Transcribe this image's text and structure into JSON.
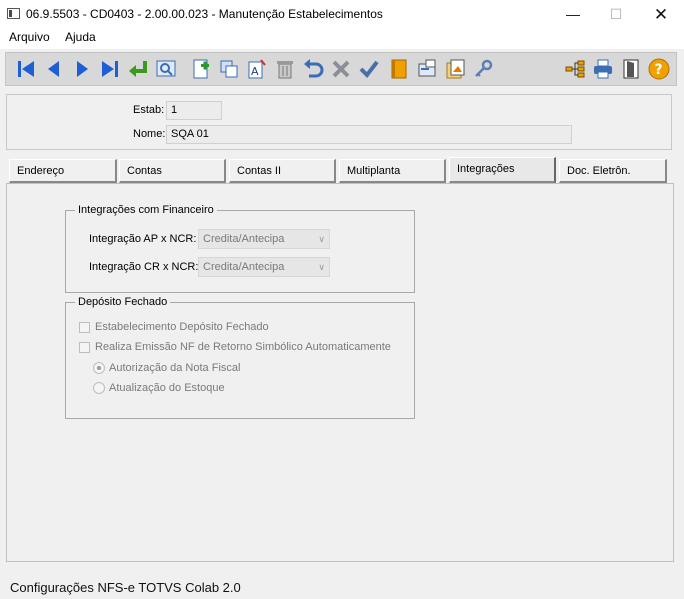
{
  "window": {
    "title": "06.9.5503 - CD0403 - 2.00.00.023 - Manutenção Estabelecimentos"
  },
  "menu": {
    "items": [
      "Arquivo",
      "Ajuda"
    ]
  },
  "toolbar": {
    "buttons": [
      "first-record-icon",
      "previous-record-icon",
      "next-record-icon",
      "last-record-icon",
      "go-to-icon",
      "search-icon",
      "add-icon",
      "copy-icon",
      "edit-icon",
      "delete-icon",
      "undo-icon",
      "cancel-icon",
      "confirm-icon",
      "book-icon",
      "screen-icon",
      "report-icon",
      "key-icon",
      "hierarchy-icon",
      "print-icon",
      "exit-door-icon",
      "help-icon"
    ]
  },
  "header": {
    "estab_label": "Estab:",
    "estab_value": "1",
    "nome_label": "Nome:",
    "nome_value": "SQA 01"
  },
  "tabs": [
    "Endereço",
    "Contas",
    "Contas II",
    "Multiplanta",
    "Integrações",
    "Doc. Eletrôn."
  ],
  "active_tab": "Integrações",
  "integracoes": {
    "legend": "Integrações com Financeiro",
    "ap_label": "Integração AP x NCR:",
    "ap_value": "Credita/Antecipa",
    "cr_label": "Integração CR x NCR:",
    "cr_value": "Credita/Antecipa"
  },
  "deposito": {
    "legend": "Depósito Fechado",
    "chk1": "Estabelecimento Depósito Fechado",
    "chk2": "Realiza Emissão NF de Retorno Simbólico Automaticamente",
    "radio1": "Autorização da Nota Fiscal",
    "radio2": "Atualização do Estoque",
    "chk1_checked": false,
    "chk2_checked": false,
    "radio_selected": "Autorização da Nota Fiscal"
  },
  "status": {
    "text": "Configurações NFS-e TOTVS Colab 2.0"
  },
  "colors": {
    "accent_blue": "#1e5fd6",
    "toolbar_bg": "#d8d8d8",
    "help_orange": "#f0a000"
  }
}
